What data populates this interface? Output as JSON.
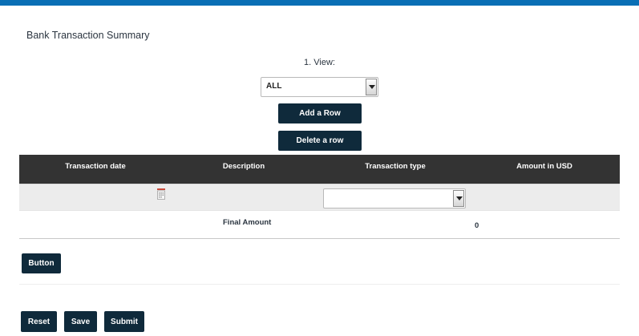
{
  "page": {
    "title": "Bank Transaction Summary"
  },
  "view": {
    "label": "1.  View:",
    "selected": "ALL"
  },
  "actions": {
    "add_row": "Add a Row",
    "delete_row": "Delete a row"
  },
  "table": {
    "columns": [
      "Transaction date",
      "Description",
      "Transaction type",
      "Amount in USD"
    ],
    "row": {
      "transaction_type": ""
    }
  },
  "summary": {
    "label": "Final Amount",
    "value": "0"
  },
  "footer": {
    "button": "Button",
    "reset": "Reset",
    "save": "Save",
    "submit": "Submit"
  },
  "colors": {
    "accent": "#0a6fb5",
    "button": "#0f2a3b",
    "header": "#333333"
  },
  "icons": {
    "date_picker": "calendar-icon",
    "dropdown": "chevron-down-icon"
  }
}
